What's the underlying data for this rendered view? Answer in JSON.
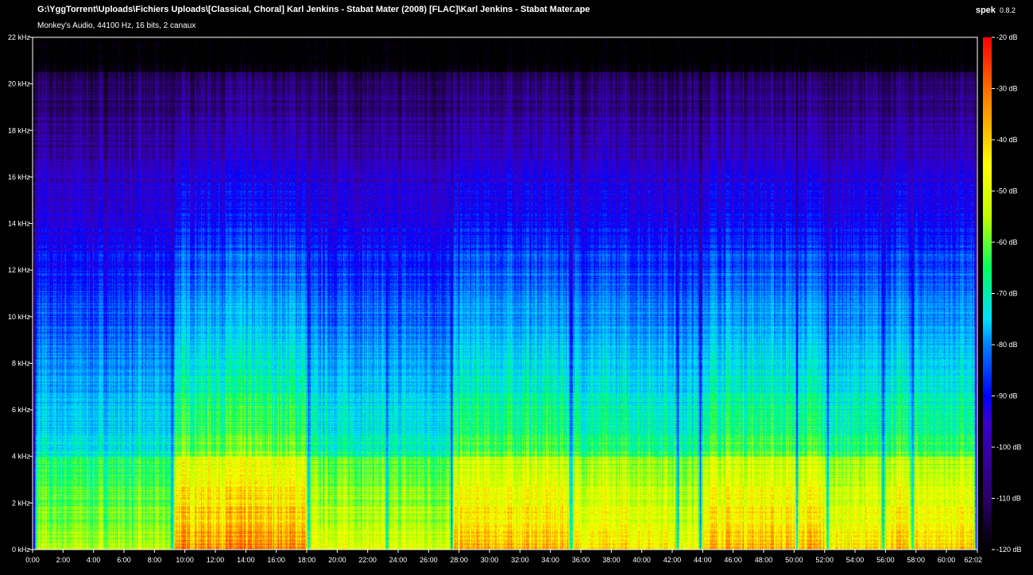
{
  "header": {
    "file_path": "G:\\YggTorrent\\Uploads\\Fichiers Uploads\\[Classical, Choral] Karl Jenkins - Stabat Mater (2008) [FLAC]\\Karl Jenkins - Stabat Mater.ape",
    "file_info": "Monkey's Audio, 44100 Hz, 16 bits, 2 canaux",
    "app_name": "spek",
    "app_version": "0.8.2"
  },
  "chart_data": {
    "type": "heatmap",
    "title": "",
    "xlabel": "",
    "ylabel": "",
    "x_unit": "mm:ss",
    "y_unit": "kHz",
    "x_range_seconds": [
      0,
      3722
    ],
    "y_range_khz": [
      0,
      22
    ],
    "x_ticks": [
      "0:00",
      "2:00",
      "4:00",
      "6:00",
      "8:00",
      "10:00",
      "12:00",
      "14:00",
      "16:00",
      "18:00",
      "20:00",
      "22:00",
      "24:00",
      "26:00",
      "28:00",
      "30:00",
      "32:00",
      "34:00",
      "36:00",
      "38:00",
      "40:00",
      "42:00",
      "44:00",
      "46:00",
      "48:00",
      "50:00",
      "52:00",
      "54:00",
      "56:00",
      "58:00",
      "60:00",
      "62:02"
    ],
    "x_tick_seconds": [
      0,
      120,
      240,
      360,
      480,
      600,
      720,
      840,
      960,
      1080,
      1200,
      1320,
      1440,
      1560,
      1680,
      1800,
      1920,
      2040,
      2160,
      2280,
      2400,
      2520,
      2640,
      2760,
      2880,
      3000,
      3120,
      3240,
      3360,
      3480,
      3600,
      3722
    ],
    "y_ticks": [
      "0 kHz",
      "2 kHz",
      "4 kHz",
      "6 kHz",
      "8 kHz",
      "10 kHz",
      "12 kHz",
      "14 kHz",
      "16 kHz",
      "18 kHz",
      "20 kHz",
      "22 kHz"
    ],
    "y_tick_values_khz": [
      0,
      2,
      4,
      6,
      8,
      10,
      12,
      14,
      16,
      18,
      20,
      22
    ],
    "colorbar": {
      "label_unit": "dB",
      "range_db": [
        -120,
        -20
      ],
      "ticks": [
        "-20 dB",
        "-30 dB",
        "-40 dB",
        "-50 dB",
        "-60 dB",
        "-70 dB",
        "-80 dB",
        "-90 dB",
        "-100 dB",
        "-110 dB",
        "-120 dB"
      ],
      "tick_values_db": [
        -20,
        -30,
        -40,
        -50,
        -60,
        -70,
        -80,
        -90,
        -100,
        -110,
        -120
      ]
    },
    "track_boundaries_seconds": [
      550,
      1085,
      1395,
      1650,
      2120,
      2540,
      2630,
      3010,
      3130,
      3350,
      3465
    ],
    "palette": [
      "#000000",
      "#2b0066",
      "#3a00cc",
      "#0000ff",
      "#0080ff",
      "#00e0ff",
      "#00ff60",
      "#c0ff00",
      "#ffff00",
      "#ff8000",
      "#ff0000"
    ]
  }
}
